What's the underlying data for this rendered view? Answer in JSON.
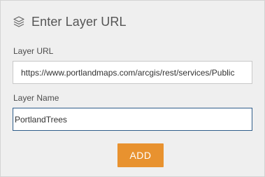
{
  "dialog": {
    "title": "Enter Layer URL",
    "icon": "layers-icon"
  },
  "fields": {
    "url": {
      "label": "Layer URL",
      "value": "https://www.portlandmaps.com/arcgis/rest/services/Public"
    },
    "name": {
      "label": "Layer Name",
      "value": "PortlandTrees"
    }
  },
  "actions": {
    "add_label": "ADD"
  },
  "colors": {
    "accent": "#e8922f",
    "focus_border": "#2f5d8a",
    "panel_background": "#efefef"
  }
}
